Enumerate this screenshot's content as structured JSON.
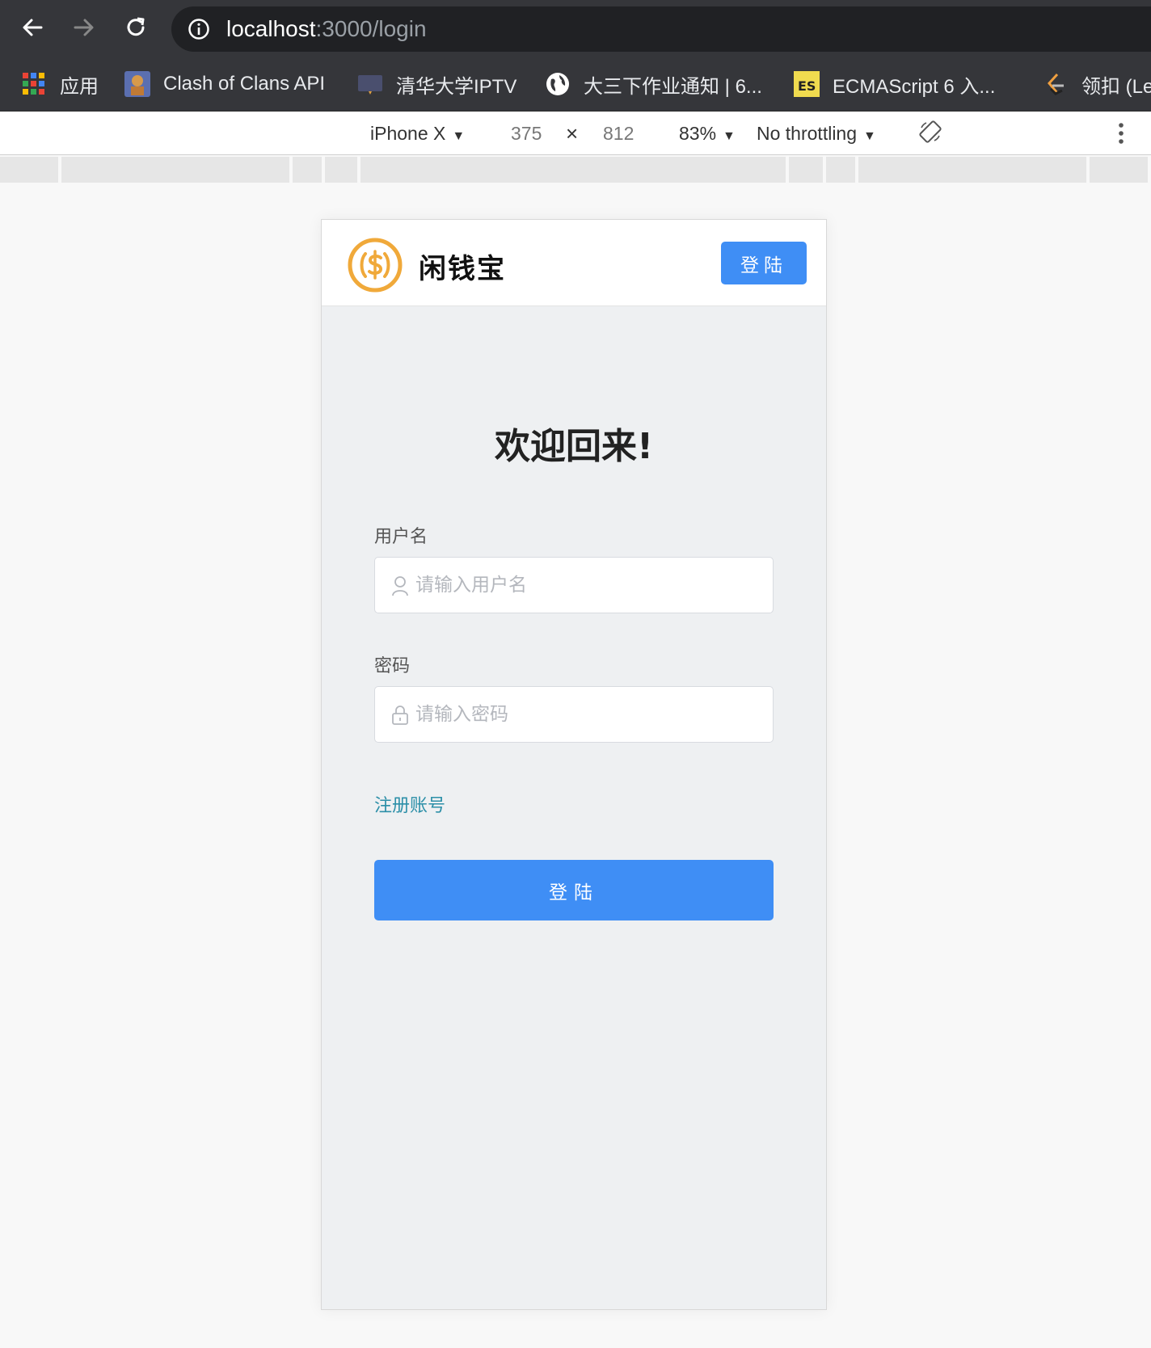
{
  "browser": {
    "url_host": "localhost",
    "url_path": ":3000/login",
    "bookmarks": [
      {
        "icon": "apps-grid-icon",
        "label": "应用"
      },
      {
        "icon": "clash-of-clans-favicon",
        "label": "Clash of Clans API"
      },
      {
        "icon": "tv-favicon",
        "label": "清华大学IPTV"
      },
      {
        "icon": "globe-icon",
        "label": "大三下作业通知 | 6..."
      },
      {
        "icon": "es-favicon",
        "label": "ECMAScript 6 入..."
      },
      {
        "icon": "leetcode-favicon",
        "label": "领扣 (Le"
      }
    ]
  },
  "device_toolbar": {
    "device": "iPhone X",
    "width": "375",
    "times": "×",
    "height": "812",
    "zoom": "83%",
    "throttling": "No throttling"
  },
  "app": {
    "brand": "闲钱宝",
    "header_login": "登陆",
    "welcome": "欢迎回来!",
    "username_label": "用户名",
    "username_placeholder": "请输入用户名",
    "password_label": "密码",
    "password_placeholder": "请输入密码",
    "register_link": "注册账号",
    "login_button": "登陆"
  },
  "colors": {
    "primary": "#3f8ef5",
    "link": "#2c8fa8",
    "logo": "#f0a93a",
    "chrome_dark": "#35363a"
  }
}
